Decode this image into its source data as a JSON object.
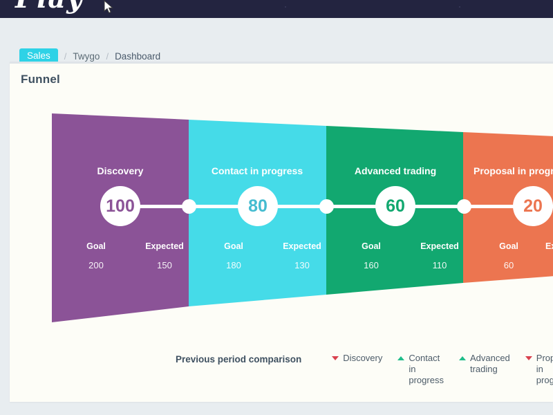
{
  "navbar": {
    "logo_text": "Play"
  },
  "breadcrumb": {
    "badge": "Sales",
    "sep": "/",
    "items": [
      {
        "label": "Twygo"
      },
      {
        "label": "Dashboard"
      }
    ]
  },
  "card": {
    "title": "Funnel"
  },
  "chart_data": {
    "type": "funnel",
    "title": "Funnel",
    "goal_label": "Goal",
    "expected_label": "Expected",
    "stages": [
      {
        "name": "Discovery",
        "value": "100",
        "goal": "200",
        "expected": "150",
        "color": "#8b5397",
        "trend": "down"
      },
      {
        "name": "Contact in progress",
        "value": "80",
        "goal": "180",
        "expected": "130",
        "color": "#45dbe8",
        "trend": "up"
      },
      {
        "name": "Advanced trading",
        "value": "60",
        "goal": "160",
        "expected": "110",
        "color": "#12a870",
        "trend": "up"
      },
      {
        "name": "Proposal in progress",
        "value": "20",
        "goal": "60",
        "expected": "",
        "color": "#ec7550",
        "trend": "down"
      }
    ]
  },
  "legend": {
    "title": "Previous period comparison",
    "items": [
      {
        "label": "Discovery",
        "trend": "down"
      },
      {
        "label": "Contact in progress",
        "trend": "up"
      },
      {
        "label": "Advanced trading",
        "trend": "up"
      },
      {
        "label": "Proposal in progress",
        "trend": "down"
      }
    ],
    "colors": {
      "down": "#d9414e",
      "up": "#1fbd8a"
    }
  }
}
